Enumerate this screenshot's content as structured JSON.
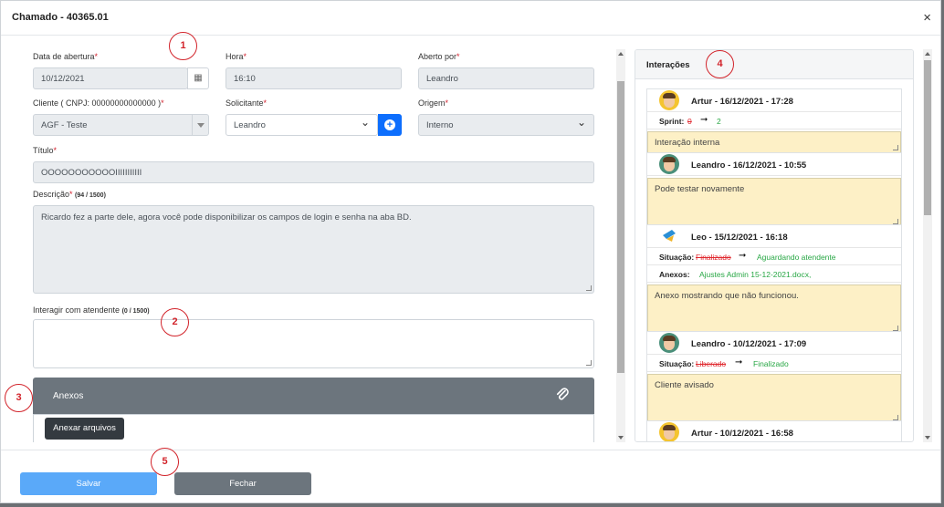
{
  "header": {
    "title": "Chamado - 40365.01",
    "close_glyph": "×"
  },
  "form": {
    "data_abertura": {
      "label": "Data de abertura",
      "value": "10/12/2021"
    },
    "hora": {
      "label": "Hora",
      "value": "16:10"
    },
    "aberto_por": {
      "label": "Aberto por",
      "value": "Leandro"
    },
    "cliente": {
      "label": "Cliente ( CNPJ: 00000000000000 )",
      "value": "AGF - Teste"
    },
    "solicitante": {
      "label": "Solicitante",
      "value": "Leandro"
    },
    "origem": {
      "label": "Origem",
      "value": "Interno"
    },
    "titulo": {
      "label": "Título",
      "value": "OOOOOOOOOOOIIIIIIIIIII"
    },
    "descricao": {
      "label": "Descrição",
      "counter": "(94 / 1500)",
      "value": "Ricardo fez a parte dele, agora você pode disponibilizar os campos de login e senha na aba BD."
    },
    "interagir": {
      "label": "Interagir com atendente",
      "counter": "(0 / 1500)",
      "value": ""
    },
    "req_mark": "*"
  },
  "anexos": {
    "title": "Anexos",
    "button": "Anexar arquivos"
  },
  "interacoes": {
    "title": "Interações",
    "items": [
      {
        "author": "Artur - 16/12/2021 - 17:28",
        "meta_label": "Sprint:",
        "old": "0",
        "new": "2",
        "note": "Interação interna"
      },
      {
        "author": "Leandro - 16/12/2021 - 10:55",
        "note": "Pode testar novamente"
      },
      {
        "author": "Leo - 15/12/2021 - 16:18",
        "meta_label": "Situação:",
        "old": "Finalizado",
        "new": "Aguardando atendente",
        "anexos_label": "Anexos:",
        "anexos_value": "Ajustes Admin 15-12-2021.docx,",
        "note": "Anexo mostrando que não funcionou."
      },
      {
        "author": "Leandro - 10/12/2021 - 17:09",
        "meta_label": "Situação:",
        "old": "Liberado",
        "new": "Finalizado",
        "note": "Cliente avisado"
      },
      {
        "author": "Artur - 10/12/2021 - 16:58"
      }
    ],
    "arrow": "➞"
  },
  "footer": {
    "save": "Salvar",
    "close": "Fechar"
  },
  "annotations": [
    "1",
    "2",
    "3",
    "4",
    "5"
  ],
  "colors": {
    "primary": "#0d6efd",
    "save": "#5aa9f9",
    "secondary": "#6c757d",
    "note_bg": "#fdf0c6",
    "annotation": "#d2232a"
  }
}
